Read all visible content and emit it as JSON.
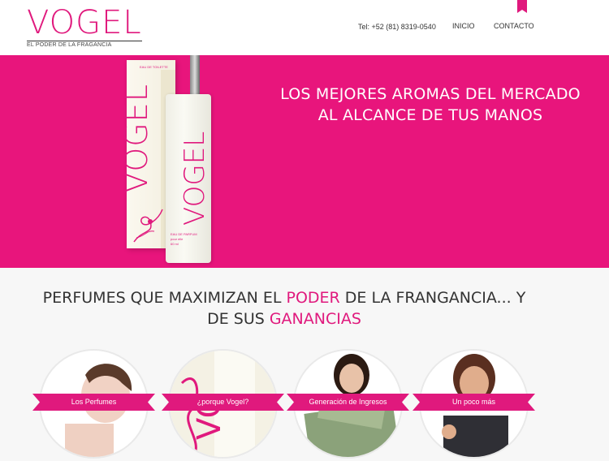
{
  "brand": {
    "logo": "VOGEL",
    "tagline": "EL PODER DE LA FRAGANCIA",
    "accent_color": "#e0197d"
  },
  "header": {
    "phone": "Tel: +52 (81) 8319-0540",
    "nav": [
      {
        "label": "INICIO"
      },
      {
        "label": "CONTACTO"
      }
    ]
  },
  "hero": {
    "background": "#e8157c",
    "line1": "LOS MEJORES AROMAS DEL MERCADO",
    "line2": "AL ALCANCE DE TUS MANOS",
    "box_label": "EAU DE TOILETTE",
    "box_brand": "VOGEL",
    "bottle_brand": "VOGEL",
    "bottle_label_1": "EAU DE PARFUM",
    "bottle_label_2": "pour elle",
    "bottle_label_3": "60 ml"
  },
  "section": {
    "headline_part1": "PERFUMES QUE MAXIMIZAN EL ",
    "headline_accent1": "PODER",
    "headline_part2": " DE LA FRANGANCIA... Y DE SUS ",
    "headline_accent2": "GANANCIAS"
  },
  "cards": [
    {
      "label": "Los Perfumes"
    },
    {
      "label": "¿porque Vogel?"
    },
    {
      "label": "Generación de Ingresos"
    },
    {
      "label": "Un poco más"
    }
  ]
}
